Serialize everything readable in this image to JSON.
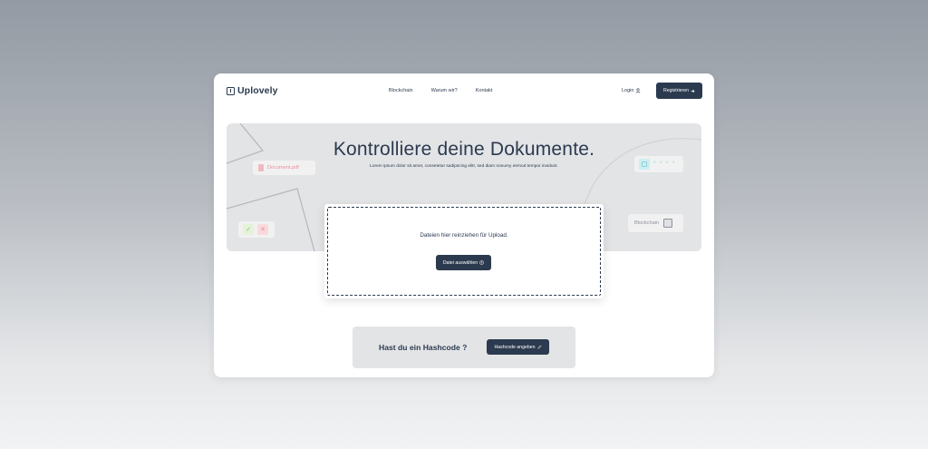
{
  "app": {
    "logo_text": "Uplovely"
  },
  "nav": {
    "items": [
      "Blockchain",
      "Warum wir?",
      "Kontakt"
    ]
  },
  "auth": {
    "login_label": "Login",
    "register_label": "Registrieren"
  },
  "hero": {
    "title": "Kontrolliere deine Dokumente.",
    "subtitle": "Lorem ipsum dolor sit amet, consetetur sadipscing elitr, sed diam nonumy eirmod tempor invidunt.",
    "doc_label": "Document.pdf",
    "scan_dots": "* * * *",
    "chain_label": "Blockchain"
  },
  "upload": {
    "instruction": "Dateien hier reinziehen für Upload.",
    "choose_label": "Datei auswählen"
  },
  "hashcode": {
    "question": "Hast du ein Hashcode ?",
    "button_label": "Hashcode angeben"
  },
  "colors": {
    "primary": "#2c3a4f",
    "panel": "#e3e4e6",
    "error": "#e78d99",
    "success": "#8ec06b",
    "accent": "#8fd3d8"
  },
  "icons": {
    "login": "user-icon",
    "register": "arrow-right-icon",
    "upload": "upload-icon",
    "hash": "pencil-icon",
    "status_ok": "check-icon",
    "status_no": "x-icon",
    "scan": "qr-scan-icon",
    "chain": "blockchain-icon",
    "doc": "document-icon"
  }
}
